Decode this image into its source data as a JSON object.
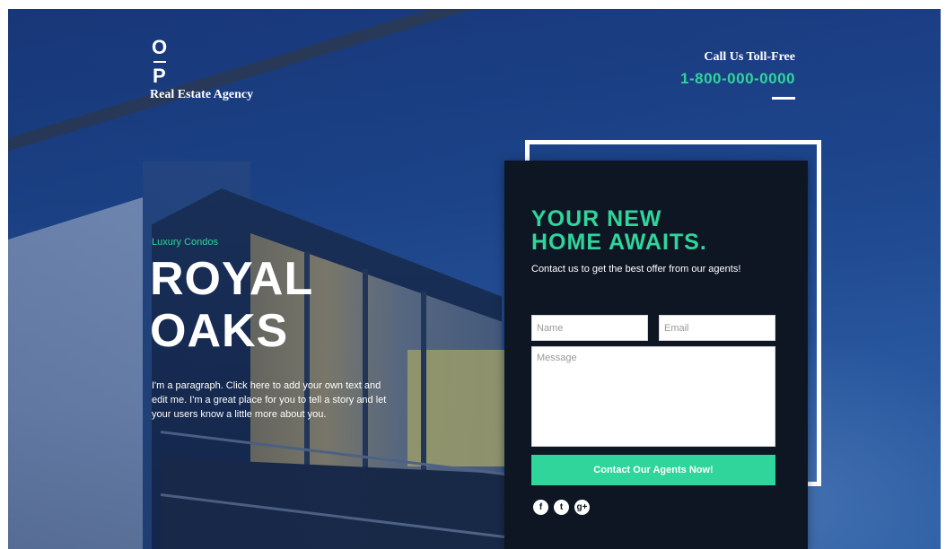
{
  "brand": {
    "logo_top_letter": "O",
    "logo_bottom_letter": "P",
    "tagline": "Real Estate Agency"
  },
  "contact_bar": {
    "label": "Call Us Toll-Free",
    "phone": "1-800-000-0000"
  },
  "hero": {
    "eyebrow": "Luxury Condos",
    "title_line1": "ROYAL",
    "title_line2": "OAKS",
    "paragraph": "I'm a paragraph. Click here to add your own text and edit me. I'm a great place for you to tell a story and let your users know a little more about you."
  },
  "form": {
    "heading_line1": "YOUR NEW",
    "heading_line2": "HOME AWAITS.",
    "subheading": "Contact us to get the best offer from our agents!",
    "name_placeholder": "Name",
    "email_placeholder": "Email",
    "message_placeholder": "Message",
    "submit_label": "Contact Our Agents Now!"
  },
  "social": {
    "icons": [
      "facebook-icon",
      "twitter-icon",
      "google-plus-icon"
    ],
    "glyphs": [
      "f",
      "t",
      "g+"
    ]
  },
  "colors": {
    "accent": "#2fd59b",
    "panel_background": "#0e1624",
    "page_background": "#1f4a92"
  }
}
